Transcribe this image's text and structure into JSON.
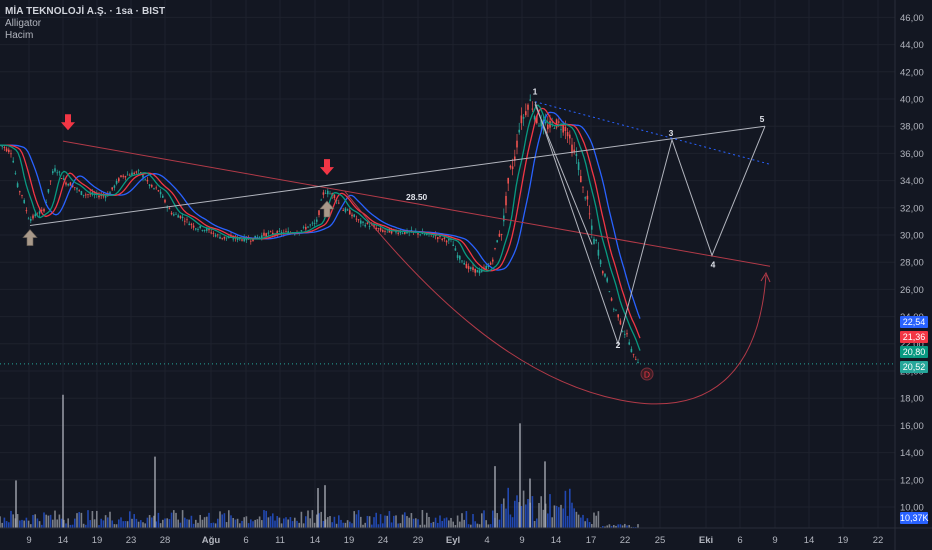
{
  "legend": {
    "title": "MİA TEKNOLOJİ A.Ş. · 1sa · BIST",
    "indicator1": "Alligator",
    "indicator2": "Hacim"
  },
  "price_tags": [
    {
      "label": "22,54",
      "value": 22.54,
      "color": "#2962ff"
    },
    {
      "label": "21,36",
      "value": 21.36,
      "color": "#f23645"
    },
    {
      "label": "20,80",
      "value": 20.8,
      "color": "#089981"
    },
    {
      "label": "20,52",
      "value": 20.52,
      "color": "#26a69a"
    }
  ],
  "volume_tag": {
    "label": "10,37K",
    "color": "#2962ff"
  },
  "annotations": {
    "wave_labels": [
      "1",
      "2",
      "3",
      "4",
      "5"
    ],
    "level_label": "28.50",
    "dividend_marker": "D"
  },
  "colors": {
    "background": "#131722",
    "grid": "#1e222d",
    "axis_text": "#b2b5be",
    "up": "#26a69a",
    "down": "#ef5350",
    "jaw": "#2962ff",
    "teeth": "#f23645",
    "lips": "#089981",
    "trend_red": "#b23a48",
    "trend_white": "#b2b5be",
    "arrow_red": "#f23645",
    "arrow_tan": "#a8998a"
  },
  "chart_data": {
    "type": "candlestick",
    "y_axis_ticks": [
      "46,00",
      "44,00",
      "42,00",
      "40,00",
      "38,00",
      "36,00",
      "34,00",
      "32,00",
      "30,00",
      "28,00",
      "26,00",
      "24,00",
      "22,00",
      "20,00",
      "18,00",
      "16,00",
      "14,00",
      "12,00",
      "10,00"
    ],
    "ylim": [
      8.5,
      46.7
    ],
    "x_axis_ticks": [
      "9",
      "14",
      "19",
      "23",
      "28",
      "Ağu",
      "6",
      "11",
      "14",
      "19",
      "24",
      "29",
      "Eyl",
      "4",
      "9",
      "14",
      "17",
      "22",
      "25",
      "Eki",
      "6",
      "9",
      "14",
      "19",
      "22"
    ],
    "price_anchors": [
      {
        "t": 0,
        "p": 36.6
      },
      {
        "t": 10,
        "p": 36.2
      },
      {
        "t": 20,
        "p": 33.2
      },
      {
        "t": 30,
        "p": 31.2
      },
      {
        "t": 42,
        "p": 31.7
      },
      {
        "t": 55,
        "p": 34.8
      },
      {
        "t": 68,
        "p": 33.8
      },
      {
        "t": 85,
        "p": 33.0
      },
      {
        "t": 105,
        "p": 32.9
      },
      {
        "t": 125,
        "p": 34.4
      },
      {
        "t": 138,
        "p": 34.6
      },
      {
        "t": 155,
        "p": 33.4
      },
      {
        "t": 175,
        "p": 31.5
      },
      {
        "t": 200,
        "p": 30.5
      },
      {
        "t": 225,
        "p": 29.8
      },
      {
        "t": 250,
        "p": 29.7
      },
      {
        "t": 270,
        "p": 30.1
      },
      {
        "t": 295,
        "p": 30.2
      },
      {
        "t": 315,
        "p": 30.8
      },
      {
        "t": 325,
        "p": 33.2
      },
      {
        "t": 332,
        "p": 33.0
      },
      {
        "t": 345,
        "p": 31.8
      },
      {
        "t": 365,
        "p": 30.8
      },
      {
        "t": 385,
        "p": 30.3
      },
      {
        "t": 410,
        "p": 30.2
      },
      {
        "t": 430,
        "p": 30.0
      },
      {
        "t": 450,
        "p": 29.6
      },
      {
        "t": 460,
        "p": 28.3
      },
      {
        "t": 470,
        "p": 27.5
      },
      {
        "t": 480,
        "p": 27.3
      },
      {
        "t": 490,
        "p": 27.8
      },
      {
        "t": 500,
        "p": 30.0
      },
      {
        "t": 512,
        "p": 35.0
      },
      {
        "t": 522,
        "p": 38.5
      },
      {
        "t": 530,
        "p": 39.8
      },
      {
        "t": 538,
        "p": 38.3
      },
      {
        "t": 548,
        "p": 38.0
      },
      {
        "t": 556,
        "p": 38.2
      },
      {
        "t": 565,
        "p": 37.9
      },
      {
        "t": 575,
        "p": 36.0
      },
      {
        "t": 585,
        "p": 33.0
      },
      {
        "t": 595,
        "p": 29.5
      },
      {
        "t": 605,
        "p": 27.0
      },
      {
        "t": 615,
        "p": 24.5
      },
      {
        "t": 625,
        "p": 22.8
      },
      {
        "t": 635,
        "p": 21.0
      },
      {
        "t": 640,
        "p": 20.6
      }
    ],
    "alligator": {
      "jaw_lag": 13,
      "teeth_lag": 8,
      "lips_lag": 5
    },
    "volume_scale_max": 14500,
    "volume_spikes": [
      {
        "t": 63,
        "v": 14000
      },
      {
        "t": 155,
        "v": 7500
      },
      {
        "t": 520,
        "v": 11000
      },
      {
        "t": 545,
        "v": 7000
      },
      {
        "t": 495,
        "v": 6500
      },
      {
        "t": 325,
        "v": 4500
      },
      {
        "t": 16,
        "v": 5000
      },
      {
        "t": 318,
        "v": 4200
      },
      {
        "t": 530,
        "v": 5200
      }
    ],
    "drawings": {
      "red_trendline": {
        "from": {
          "t": 63,
          "p": 36.9
        },
        "to": {
          "t": 770,
          "p": 27.7
        }
      },
      "white_trendline": {
        "from": {
          "t": 30,
          "p": 30.7
        },
        "to": {
          "t": 765,
          "p": 38.0
        }
      },
      "level_value": 28.5,
      "wave_path": [
        {
          "t": 535,
          "p": 39.8,
          "label": "1"
        },
        {
          "t": 618,
          "p": 22.0,
          "label": "2"
        },
        {
          "t": 672,
          "p": 37.0,
          "label": "3"
        },
        {
          "t": 712,
          "p": 28.5,
          "label": "4"
        },
        {
          "t": 765,
          "p": 38.0,
          "label": "5"
        }
      ],
      "arrows_down_red": [
        {
          "t": 68,
          "p": 37.7
        },
        {
          "t": 327,
          "p": 34.4
        }
      ],
      "arrows_up_tan": [
        {
          "t": 30,
          "p": 30.4
        },
        {
          "t": 327,
          "p": 32.5
        }
      ]
    }
  }
}
